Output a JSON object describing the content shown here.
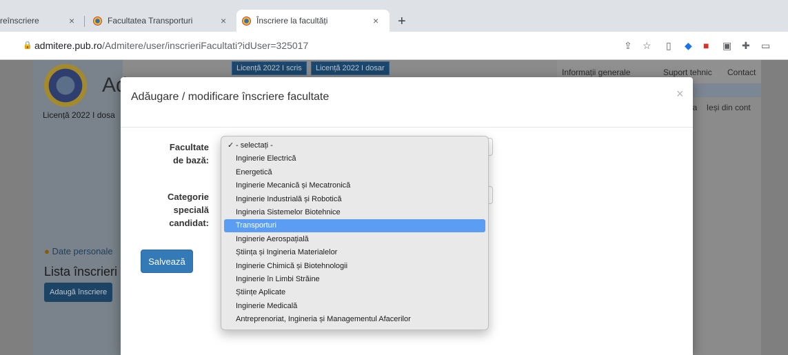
{
  "browser": {
    "tabs": [
      {
        "label": "reînscriere",
        "favicon": "document-icon"
      },
      {
        "label": "Facultatea Transporturi",
        "favicon": "upb-logo-icon"
      },
      {
        "label": "Înscriere la facultăți",
        "favicon": "upb-logo-icon"
      }
    ],
    "new_tab": "+",
    "tab_close": "×",
    "url_host": "admitere.pub.ro",
    "url_path": "/Admitere/user/inscrieriFacultati?idUser=325017"
  },
  "page": {
    "logo_partial": "Ad",
    "session_label": "Licență 2022 I dosa",
    "nav_pills": [
      "Licență 2022 I scris",
      "Licență 2022 I dosar"
    ],
    "top_links": [
      "Informații generale",
      "Suport tehnic",
      "Contact"
    ],
    "right_links": [
      "la",
      "Ieși din cont"
    ],
    "date_personale": "Date personale",
    "lista_title": "Lista înscrieri",
    "add_button": "Adaugă înscriere"
  },
  "modal": {
    "title": "Adăugare / modificare înscriere facultate",
    "close": "×",
    "field1_label_line1": "Facultate",
    "field1_label_line2": "de bază:",
    "field2_label_line1": "Categorie",
    "field2_label_line2": "specială",
    "field2_label_line3": "candidat:",
    "save": "Salvează"
  },
  "dropdown": {
    "checked_index": 0,
    "selected_index": 6,
    "options": [
      "- selectați -",
      "Inginerie Electrică",
      "Energetică",
      "Inginerie Mecanică și Mecatronică",
      "Inginerie Industrială și Robotică",
      "Ingineria Sistemelor Biotehnice",
      "Transporturi",
      "Inginerie Aerospațială",
      "Știința și Ingineria Materialelor",
      "Inginerie Chimică și Biotehnologii",
      "Inginerie în Limbi Străine",
      "Științe Aplicate",
      "Inginerie Medicală",
      "Antreprenoriat, Ingineria și Managementul Afacerilor"
    ]
  },
  "colors": {
    "highlight": "#5a9df3",
    "primary_button": "#337ab7"
  }
}
